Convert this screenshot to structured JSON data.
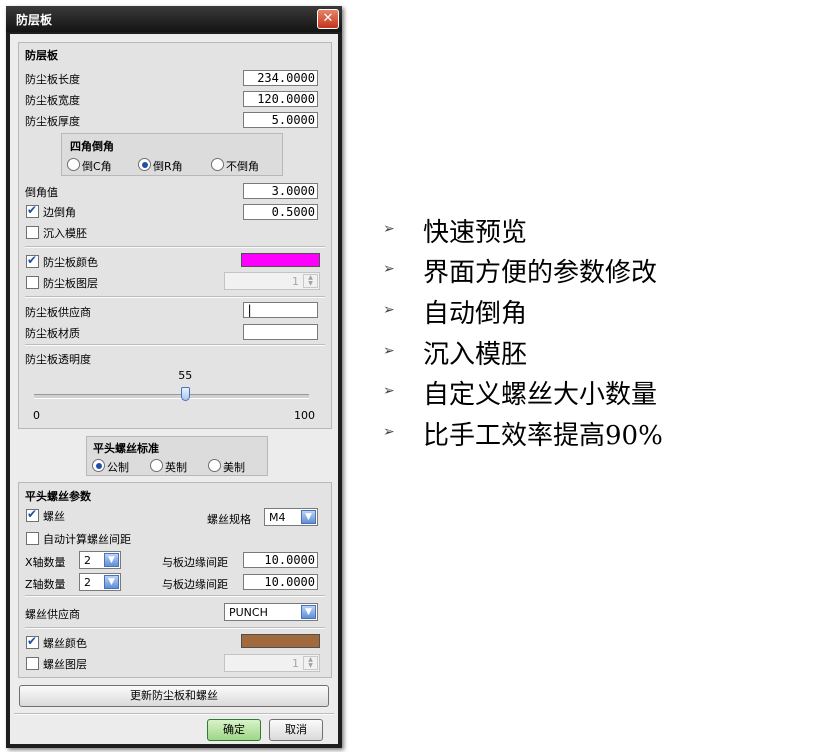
{
  "window": {
    "title": "防层板",
    "close_glyph": "✕"
  },
  "panel": {
    "title": "防层板",
    "length_label": "防尘板长度",
    "length_value": "234.0000",
    "width_label": "防尘板宽度",
    "width_value": "120.0000",
    "thickness_label": "防尘板厚度",
    "thickness_value": "5.0000",
    "corner": {
      "title": "四角倒角",
      "options": [
        "倒C角",
        "倒R角",
        "不倒角"
      ],
      "selected": "倒R角"
    },
    "chamfer_label": "倒角值",
    "chamfer_value": "3.0000",
    "edge_chamfer_label": "边倒角",
    "edge_chamfer_checked": true,
    "edge_chamfer_value": "0.5000",
    "sink_label": "沉入模胚",
    "sink_checked": false,
    "color_label": "防尘板颜色",
    "color_checked": true,
    "color_hex": "#ff00ff",
    "layer_label": "防尘板图层",
    "layer_checked": false,
    "layer_value": "1",
    "supplier_label": "防尘板供应商",
    "supplier_value": "|",
    "material_label": "防尘板材质",
    "material_value": "",
    "transparency_label": "防尘板透明度",
    "transparency_value": 55,
    "transparency_display": "55",
    "slider_min": "0",
    "slider_max": "100"
  },
  "screw_standard": {
    "title": "平头螺丝标准",
    "options": [
      "公制",
      "英制",
      "美制"
    ],
    "selected": "公制"
  },
  "screw_params": {
    "title": "平头螺丝参数",
    "screw_label": "螺丝",
    "screw_checked": true,
    "spec_label": "螺丝规格",
    "spec_value": "M4",
    "auto_spacing_label": "自动计算螺丝间距",
    "auto_spacing_checked": false,
    "x_count_label": "X轴数量",
    "x_count_value": "2",
    "x_edge_label": "与板边缘间距",
    "x_edge_value": "10.0000",
    "z_count_label": "Z轴数量",
    "z_count_value": "2",
    "z_edge_label": "与板边缘间距",
    "z_edge_value": "10.0000",
    "supplier_label": "螺丝供应商",
    "supplier_value": "PUNCH",
    "color_label": "螺丝颜色",
    "color_checked": true,
    "color_hex": "#a06a3c",
    "layer_label": "螺丝图层",
    "layer_checked": false,
    "layer_value": "1"
  },
  "update_button_label": "更新防尘板和螺丝",
  "ok_label": "确定",
  "cancel_label": "取消",
  "features": [
    "快速预览",
    "界面方便的参数修改",
    "自动倒角",
    "沉入模胚",
    "自定义螺丝大小数量",
    "比手工效率提高90%"
  ],
  "bullet_glyph": "➢"
}
